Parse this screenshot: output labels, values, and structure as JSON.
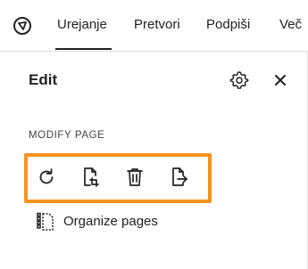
{
  "header": {
    "tabs": [
      {
        "label": "Urejanje",
        "active": true
      },
      {
        "label": "Pretvori",
        "active": false
      },
      {
        "label": "Podpiši",
        "active": false
      },
      {
        "label": "Več",
        "active": false
      }
    ],
    "logo_icon": "acrobat-logo-icon"
  },
  "panel": {
    "title": "Edit",
    "settings_icon": "gear-icon",
    "close_icon": "close-icon",
    "section": {
      "heading": "MODIFY PAGE",
      "tools": [
        {
          "icon": "rotate-icon"
        },
        {
          "icon": "crop-page-icon"
        },
        {
          "icon": "delete-icon"
        },
        {
          "icon": "extract-page-icon"
        }
      ],
      "highlight_color": "#f6921e"
    },
    "organize": {
      "icon": "organize-pages-icon",
      "label": "Organize pages"
    }
  }
}
